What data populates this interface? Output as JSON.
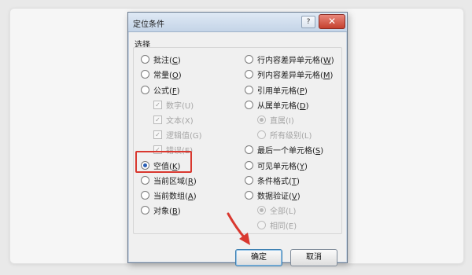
{
  "dialog": {
    "title": "定位条件",
    "help_label": "?",
    "close_label": "✕",
    "group_label": "选择",
    "left_options": [
      {
        "text": "批注(",
        "key": "C",
        "end": ")",
        "checked": false
      },
      {
        "text": "常量(",
        "key": "O",
        "end": ")",
        "checked": false
      },
      {
        "text": "公式(",
        "key": "F",
        "end": ")",
        "checked": false
      },
      {
        "text": "空值(",
        "key": "K",
        "end": ")",
        "checked": true
      },
      {
        "text": "当前区域(",
        "key": "R",
        "end": ")",
        "checked": false
      },
      {
        "text": "当前数组(",
        "key": "A",
        "end": ")",
        "checked": false
      },
      {
        "text": "对象(",
        "key": "B",
        "end": ")",
        "checked": false
      }
    ],
    "formula_subs": [
      {
        "label": "数字(U)",
        "checked": true
      },
      {
        "label": "文本(X)",
        "checked": true
      },
      {
        "label": "逻辑值(G)",
        "checked": true
      },
      {
        "label": "错误(E)",
        "checked": true
      }
    ],
    "right_options": [
      {
        "text": "行内容差异单元格(",
        "key": "W",
        "end": ")",
        "checked": false
      },
      {
        "text": "列内容差异单元格(",
        "key": "M",
        "end": ")",
        "checked": false
      },
      {
        "text": "引用单元格(",
        "key": "P",
        "end": ")",
        "checked": false
      },
      {
        "text": "从属单元格(",
        "key": "D",
        "end": ")",
        "checked": false
      },
      {
        "text": "最后一个单元格(",
        "key": "S",
        "end": ")",
        "checked": false
      },
      {
        "text": "可见单元格(",
        "key": "Y",
        "end": ")",
        "checked": false
      },
      {
        "text": "条件格式(",
        "key": "T",
        "end": ")",
        "checked": false
      },
      {
        "text": "数据验证(",
        "key": "V",
        "end": ")",
        "checked": false
      }
    ],
    "dependent_subs": [
      {
        "label": "直属(I)",
        "checked": true
      },
      {
        "label": "所有级别(L)",
        "checked": false
      }
    ],
    "validation_subs": [
      {
        "label": "全部(L)",
        "checked": true
      },
      {
        "label": "相同(E)",
        "checked": false
      }
    ],
    "ok_label": "确定",
    "cancel_label": "取消"
  },
  "colors": {
    "highlight": "#d9382f",
    "radio_selected": "#2a5fb6"
  }
}
